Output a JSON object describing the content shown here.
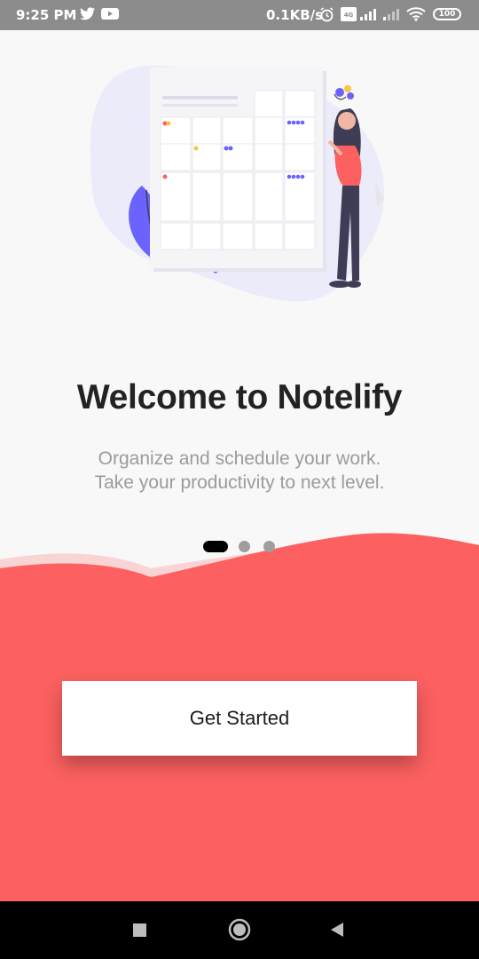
{
  "status_bar": {
    "time": "9:25 PM",
    "network_speed": "0.1KB/s",
    "battery": "100",
    "icons": [
      "twitter-icon",
      "youtube-icon",
      "alarm-icon",
      "volte-icon",
      "signal-icon",
      "signal-icon",
      "wifi-icon",
      "battery-icon"
    ]
  },
  "onboarding": {
    "title": "Welcome to Notelify",
    "subtitle_line1": "Organize and schedule your work.",
    "subtitle_line2": "Take your productivity to next level.",
    "page_count": 3,
    "current_page": 1
  },
  "cta": {
    "label": "Get Started"
  },
  "colors": {
    "accent": "#fc6060",
    "accent_light": "#f9d4d4",
    "background": "#f8f8f8",
    "illustration_purple": "#6c63ff"
  },
  "navigation_bar": {
    "buttons": [
      "recents-button",
      "home-button",
      "back-button"
    ]
  }
}
